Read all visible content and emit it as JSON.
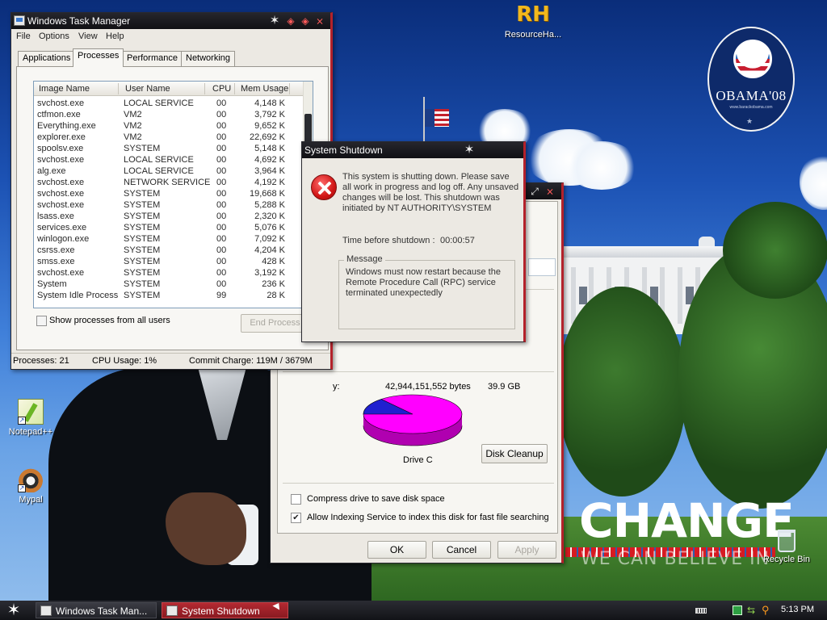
{
  "desktop": {
    "icons": [
      {
        "label": "ResourceHa..."
      },
      {
        "label": "Notepad++"
      },
      {
        "label": "Mypal"
      },
      {
        "label": "Recycle Bin"
      }
    ],
    "rh_glyph": "RH",
    "obama_logo_text": "OBAMA'08",
    "change_text": "CHANGE",
    "change_sub": "WE CAN BELIEVE IN"
  },
  "taskmgr": {
    "title": "Windows Task Manager",
    "menu": [
      "File",
      "Options",
      "View",
      "Help"
    ],
    "tabs": [
      "Applications",
      "Processes",
      "Performance",
      "Networking"
    ],
    "active_tab": "Processes",
    "columns": [
      "Image Name",
      "User Name",
      "CPU",
      "Mem Usage"
    ],
    "processes": [
      {
        "name": "svchost.exe",
        "user": "LOCAL SERVICE",
        "cpu": "00",
        "mem": "4,148 K"
      },
      {
        "name": "ctfmon.exe",
        "user": "VM2",
        "cpu": "00",
        "mem": "3,792 K"
      },
      {
        "name": "Everything.exe",
        "user": "VM2",
        "cpu": "00",
        "mem": "9,652 K"
      },
      {
        "name": "explorer.exe",
        "user": "VM2",
        "cpu": "00",
        "mem": "22,692 K"
      },
      {
        "name": "spoolsv.exe",
        "user": "SYSTEM",
        "cpu": "00",
        "mem": "5,148 K"
      },
      {
        "name": "svchost.exe",
        "user": "LOCAL SERVICE",
        "cpu": "00",
        "mem": "4,692 K"
      },
      {
        "name": "alg.exe",
        "user": "LOCAL SERVICE",
        "cpu": "00",
        "mem": "3,964 K"
      },
      {
        "name": "svchost.exe",
        "user": "NETWORK SERVICE",
        "cpu": "00",
        "mem": "4,192 K"
      },
      {
        "name": "svchost.exe",
        "user": "SYSTEM",
        "cpu": "00",
        "mem": "19,668 K"
      },
      {
        "name": "svchost.exe",
        "user": "SYSTEM",
        "cpu": "00",
        "mem": "5,288 K"
      },
      {
        "name": "lsass.exe",
        "user": "SYSTEM",
        "cpu": "00",
        "mem": "2,320 K"
      },
      {
        "name": "services.exe",
        "user": "SYSTEM",
        "cpu": "00",
        "mem": "5,076 K"
      },
      {
        "name": "winlogon.exe",
        "user": "SYSTEM",
        "cpu": "00",
        "mem": "7,092 K"
      },
      {
        "name": "csrss.exe",
        "user": "SYSTEM",
        "cpu": "00",
        "mem": "4,204 K"
      },
      {
        "name": "smss.exe",
        "user": "SYSTEM",
        "cpu": "00",
        "mem": "428 K"
      },
      {
        "name": "svchost.exe",
        "user": "SYSTEM",
        "cpu": "00",
        "mem": "3,192 K"
      },
      {
        "name": "System",
        "user": "SYSTEM",
        "cpu": "00",
        "mem": "236 K"
      },
      {
        "name": "System Idle Process",
        "user": "SYSTEM",
        "cpu": "99",
        "mem": "28 K"
      }
    ],
    "show_all_label": "Show processes from all users",
    "end_process_label": "End Process",
    "status": {
      "processes": "Processes: 21",
      "cpu": "CPU Usage: 1%",
      "commit": "Commit Charge: 119M / 3679M"
    }
  },
  "shutdown": {
    "title": "System Shutdown",
    "message": "This system is shutting down. Please save all work in progress and log off. Any unsaved changes will be lost. This shutdown was initiated by NT AUTHORITY\\SYSTEM",
    "time_label": "Time before shutdown :",
    "time_value": "00:00:57",
    "group_title": "Message",
    "group_text": "Windows must now restart because the Remote Procedure Call (RPC) service terminated unexpectedly"
  },
  "props": {
    "capacity_label": "y:",
    "capacity_bytes": "42,944,151,552 bytes",
    "capacity_gb": "39.9 GB",
    "used_fraction": 0.14,
    "used_color": "#2020d0",
    "free_color": "#ff00ff",
    "drive_label": "Drive C",
    "cleanup_label": "Disk Cleanup",
    "compress_label": "Compress drive to save disk space",
    "compress_checked": "",
    "index_label": "Allow Indexing Service to index this disk for fast file searching",
    "index_checked": "✔",
    "ok_label": "OK",
    "cancel_label": "Cancel",
    "apply_label": "Apply"
  },
  "taskbar": {
    "buttons": [
      "Windows Task Man...",
      "System Shutdown"
    ],
    "clock": "5:13 PM"
  },
  "colors": {
    "accent_red": "#b3222b",
    "titlebar": "#16161b"
  }
}
